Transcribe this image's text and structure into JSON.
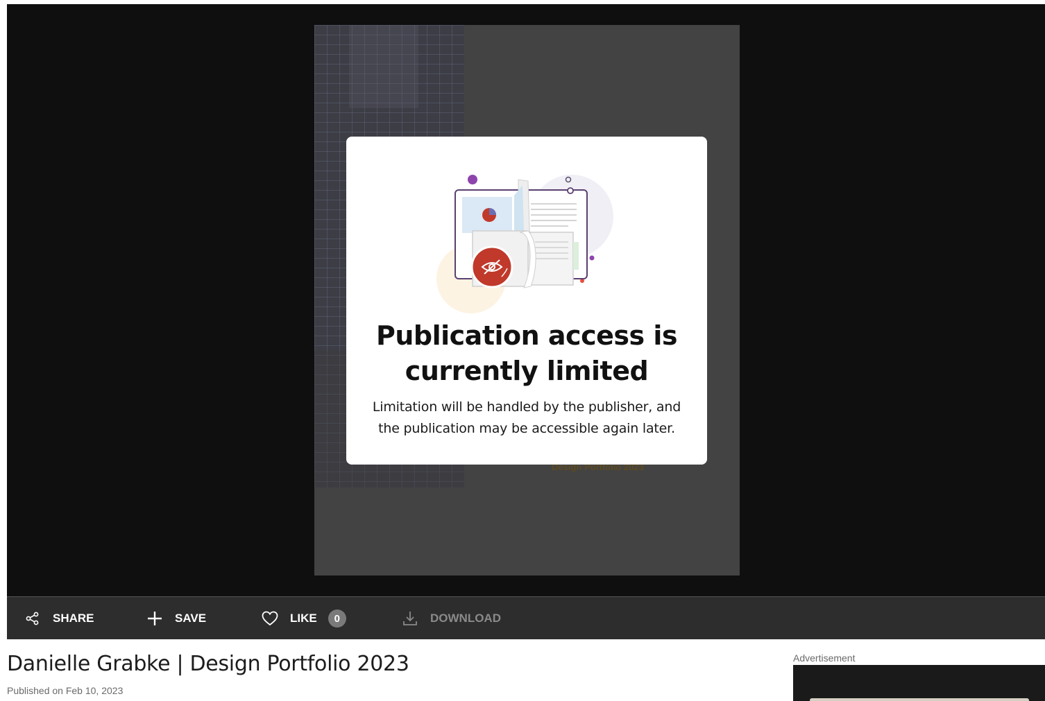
{
  "viewer": {
    "document_caption": "Design Portfolio 2023"
  },
  "modal": {
    "title_line1": "Publication access is",
    "title_line2": "currently limited",
    "body_line1": "Limitation will be handled by the publisher, and",
    "body_line2": "the publication may be accessible again later.",
    "illustration_icon": "hidden-eye-icon"
  },
  "toolbar": {
    "share_label": "SHARE",
    "share_icon": "share-icon",
    "save_label": "SAVE",
    "save_icon": "plus-icon",
    "like_label": "LIKE",
    "like_icon": "heart-icon",
    "like_count": "0",
    "download_label": "DOWNLOAD",
    "download_icon": "download-icon"
  },
  "publication": {
    "title": "Danielle Grabke | Design Portfolio 2023",
    "published": "Published on Feb 10, 2023"
  },
  "ad": {
    "label": "Advertisement"
  },
  "colors": {
    "viewer_bg": "#0f0f10",
    "toolbar_bg": "#2d2d2d",
    "accent_red": "#c0392b",
    "accent_purple": "#8e44ad"
  }
}
